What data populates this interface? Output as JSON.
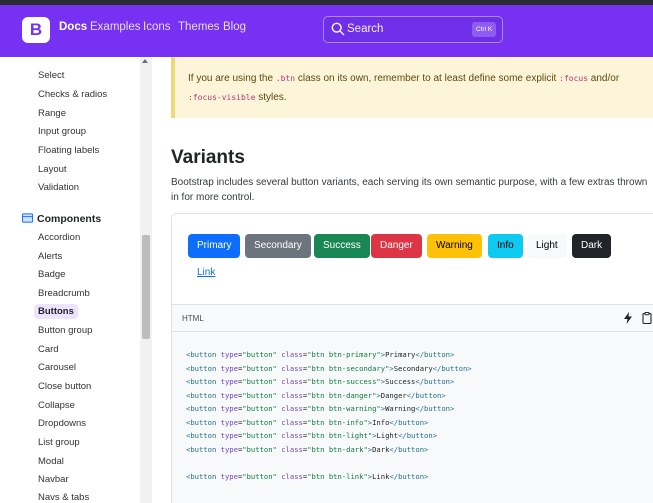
{
  "navbar": {
    "brand_letter": "B",
    "links": [
      "Docs",
      "Examples",
      "Icons",
      "Themes",
      "Blog"
    ],
    "search_placeholder": "Search",
    "search_shortcut": "Ctrl K"
  },
  "sidebar": {
    "items_top": [
      "Select",
      "Checks & radios",
      "Range",
      "Input group",
      "Floating labels",
      "Layout",
      "Validation"
    ],
    "section_heading": "Components",
    "items_components": [
      "Accordion",
      "Alerts",
      "Badge",
      "Breadcrumb",
      "Buttons",
      "Button group",
      "Card",
      "Carousel",
      "Close button",
      "Collapse",
      "Dropdowns",
      "List group",
      "Modal",
      "Navbar",
      "Navs & tabs"
    ],
    "active_item": "Buttons"
  },
  "callout": {
    "pre": "If you are using the ",
    "code1": ".btn",
    "mid": " class on its own, remember to at least define some explicit ",
    "code2": ":focus",
    "mid2": " and/or",
    "code3": ":focus-visible",
    "post": " styles."
  },
  "section": {
    "title": "Variants",
    "lead_line1": "Bootstrap includes several button variants, each serving its own semantic purpose, with a few extras thrown",
    "lead_line2": "in for more control."
  },
  "buttons": [
    {
      "label": "Primary",
      "bg": "#0d6efd",
      "fg": "#ffffff"
    },
    {
      "label": "Secondary",
      "bg": "#6c757d",
      "fg": "#ffffff"
    },
    {
      "label": "Success",
      "bg": "#198754",
      "fg": "#ffffff"
    },
    {
      "label": "Danger",
      "bg": "#dc3545",
      "fg": "#ffffff"
    },
    {
      "label": "Warning",
      "bg": "#ffc107",
      "fg": "#000000"
    },
    {
      "label": "Info",
      "bg": "#0dcaf0",
      "fg": "#000000"
    },
    {
      "label": "Light",
      "bg": "#f8f9fa",
      "fg": "#000000"
    },
    {
      "label": "Dark",
      "bg": "#212529",
      "fg": "#ffffff"
    }
  ],
  "link_button_label": "Link",
  "code": {
    "lang": "HTML",
    "variants": [
      "primary",
      "secondary",
      "success",
      "danger",
      "warning",
      "info",
      "light",
      "dark"
    ],
    "labels": [
      "Primary",
      "Secondary",
      "Success",
      "Danger",
      "Warning",
      "Info",
      "Light",
      "Dark"
    ],
    "link_line": {
      "variant": "link",
      "label": "Link"
    }
  },
  "colors": {
    "navbar": "#7631f2",
    "accent_active_bg": "#ede3fd",
    "callout_bg": "#fdf5da"
  }
}
